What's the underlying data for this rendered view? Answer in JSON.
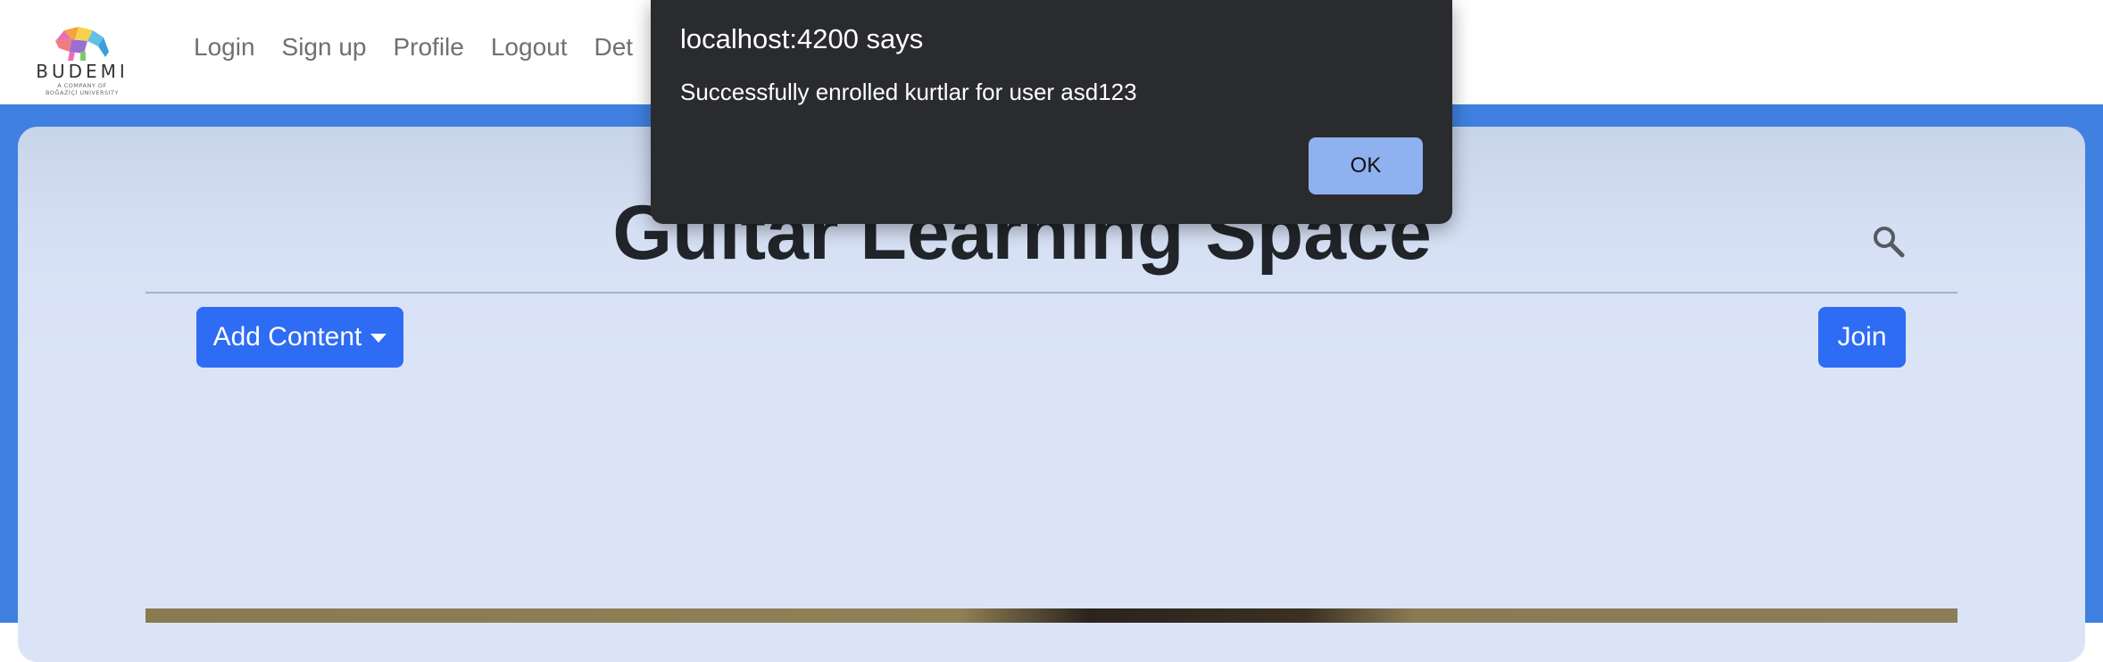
{
  "header": {
    "logo": {
      "brand": "BUDEMI",
      "tagline_line1": "A COMPANY OF",
      "tagline_line2": "BOĞAZİÇİ UNIVERSITY"
    },
    "nav": [
      "Login",
      "Sign up",
      "Profile",
      "Logout",
      "Det"
    ]
  },
  "main": {
    "title": "Guitar Learning Space",
    "search_icon": "search-icon",
    "add_content_label": "Add Content",
    "join_label": "Join"
  },
  "dialog": {
    "title": "localhost:4200 says",
    "message": "Successfully enrolled kurtlar for user asd123",
    "ok_label": "OK"
  },
  "colors": {
    "page_background": "#3f80e0",
    "primary_button": "#2e6cf3",
    "dialog_background": "#2a2b2f",
    "dialog_ok_button": "#8fb1f0"
  }
}
